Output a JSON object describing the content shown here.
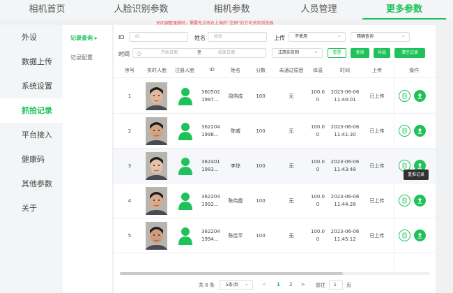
{
  "top_nav": {
    "tabs": [
      {
        "label": "相机首页",
        "active": false
      },
      {
        "label": "人脸识别参数",
        "active": false
      },
      {
        "label": "相机参数",
        "active": false
      },
      {
        "label": "人员管理",
        "active": false
      },
      {
        "label": "更多参数",
        "active": true
      }
    ]
  },
  "left_nav": {
    "items": [
      {
        "label": "外设",
        "active": false
      },
      {
        "label": "数据上传",
        "active": false
      },
      {
        "label": "系统设置",
        "active": false
      },
      {
        "label": "抓拍记录",
        "active": true
      },
      {
        "label": "平台接入",
        "active": false
      },
      {
        "label": "健康码",
        "active": false
      },
      {
        "label": "其他参数",
        "active": false
      },
      {
        "label": "关于",
        "active": false
      }
    ]
  },
  "sub_nav": {
    "items": [
      {
        "label": "记录查询 ▸",
        "active": true
      },
      {
        "label": "记录配置",
        "active": false
      }
    ]
  },
  "notice": "关闭调整速度时，需要先点击右上角的“注销”后方可关闭浏览器",
  "filters": {
    "id_label": "ID",
    "id_placeholder": "ID",
    "name_label": "姓名",
    "name_placeholder": "姓名",
    "upload_label": "上传",
    "upload_value": "不使用",
    "match_value": "精确查询",
    "time_label": "时间",
    "start_placeholder": "开始日期",
    "range_sep": "至",
    "end_placeholder": "结束日期",
    "region_value": "江西实名制"
  },
  "buttons": {
    "reset": "重置",
    "query": "查询",
    "export": "导出",
    "clear": "清空记录"
  },
  "table": {
    "columns": [
      "序号",
      "实时人脸",
      "注册人脸",
      "ID",
      "姓名",
      "分数",
      "未通过原因",
      "体温",
      "时间",
      "上传",
      "操作"
    ],
    "rows": [
      {
        "no": "1",
        "id1": "360502",
        "id2": "1997...",
        "name": "周伟成",
        "score": "100",
        "reason": "无",
        "temp1": "100.0",
        "temp2": "0",
        "date": "2023-06-06",
        "time": "11:40:01",
        "upload": "已上传"
      },
      {
        "no": "2",
        "id1": "362204",
        "id2": "1998...",
        "name": "陈威",
        "score": "100",
        "reason": "无",
        "temp1": "100.0",
        "temp2": "0",
        "date": "2023-06-06",
        "time": "11:41:30",
        "upload": "已上传"
      },
      {
        "no": "3",
        "id1": "362401",
        "id2": "1983...",
        "name": "李琼",
        "score": "100",
        "reason": "无",
        "temp1": "100.0",
        "temp2": "0",
        "date": "2023-06-06",
        "time": "11:43:48",
        "upload": "已上传"
      },
      {
        "no": "4",
        "id1": "362204",
        "id2": "1992...",
        "name": "陈伟霞",
        "score": "100",
        "reason": "无",
        "temp1": "100.0",
        "temp2": "0",
        "date": "2023-06-06",
        "time": "11:44:28",
        "upload": "已上传"
      },
      {
        "no": "5",
        "id1": "362204",
        "id2": "1994...",
        "name": "陈佳平",
        "score": "100",
        "reason": "无",
        "temp1": "100.0",
        "temp2": "0",
        "date": "2023-06-06",
        "time": "11:45:12",
        "upload": "已上传"
      }
    ]
  },
  "tooltip": "重推记录",
  "pagination": {
    "total": "共 6 条",
    "page_size": "5条/页",
    "prev": "<",
    "page1": "1",
    "page2": "2",
    "next": ">",
    "goto_label": "前往",
    "goto_value": "1",
    "goto_suffix": "页"
  },
  "icons": {
    "registered_face": "person-silhouette-icon",
    "detail": "document-icon",
    "upload": "upload-arrow-icon",
    "calendar": "calendar-icon"
  },
  "colors": {
    "accent": "#1fc25a",
    "notice": "#ee4444"
  }
}
